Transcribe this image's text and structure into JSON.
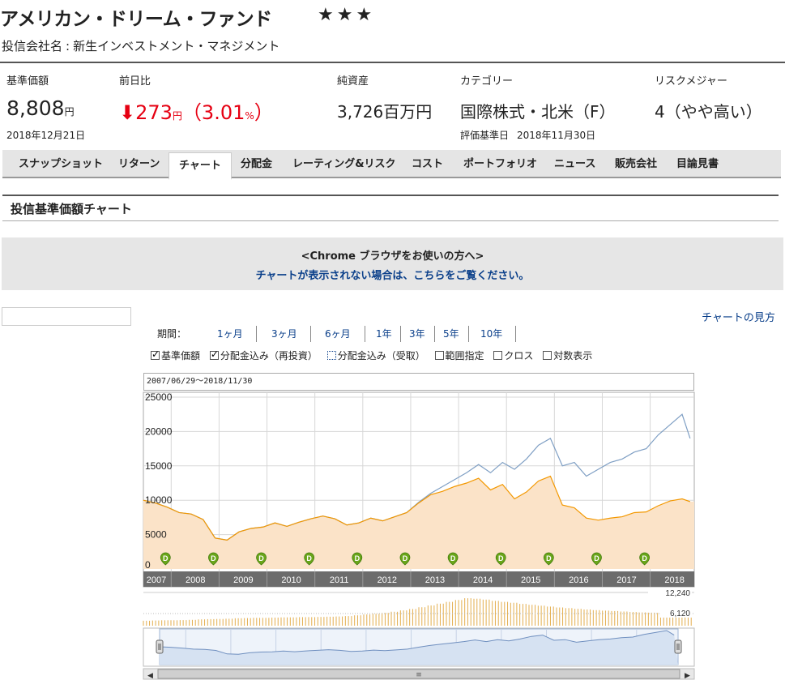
{
  "header": {
    "fund_name": "アメリカン・ドリーム・ファンド",
    "stars": "★★★",
    "company_label": "投信会社名",
    "company_name": "新生インベストメント・マネジメント"
  },
  "summary": {
    "nav": {
      "label": "基準価額",
      "value": "8,808",
      "unit": "円",
      "date": "2018年12月21日"
    },
    "change": {
      "label": "前日比",
      "arrow": "⬇",
      "value": "273",
      "unit": "円",
      "pct_open": "（3.01",
      "pct_unit": "%",
      "pct_close": "）"
    },
    "assets": {
      "label": "純資産",
      "value": "3,726百万円"
    },
    "category": {
      "label": "カテゴリー",
      "value": "国際株式・北米（F）",
      "basis_label": "評価基準日",
      "basis_date": "2018年11月30日"
    },
    "risk": {
      "label": "リスクメジャー",
      "value": "4（やや高い）"
    }
  },
  "tabs": [
    "スナップショット",
    "リターン",
    "チャート",
    "分配金",
    "レーティング&リスク",
    "コスト",
    "ポートフォリオ",
    "ニュース",
    "販売会社",
    "目論見書"
  ],
  "active_tab": "チャート",
  "section_title": "投信基準価額チャート",
  "notice": {
    "line1": "<Chrome ブラウザをお使いの方へ>",
    "line2": "チャートが表示されない場合は、こちらをご覧ください。"
  },
  "howto_link": "チャートの見方",
  "period": {
    "label": "期間：",
    "options": [
      "1ヶ月",
      "3ヶ月",
      "6ヶ月",
      "1年",
      "3年",
      "5年",
      "10年"
    ]
  },
  "options": [
    {
      "label": "基準価額",
      "checked": true
    },
    {
      "label": "分配金込み（再投資）",
      "checked": true
    },
    {
      "label": "分配金込み（受取）",
      "checked": false,
      "focused": true
    },
    {
      "label": "範囲指定",
      "checked": false
    },
    {
      "label": "クロス",
      "checked": false
    },
    {
      "label": "対数表示",
      "checked": false
    }
  ],
  "date_range": "2007/06/29～2018/11/30",
  "colors": {
    "nav_line": "#f39800",
    "nav_fill": "#fbe3c8",
    "reinvest_line": "#7f9fc4",
    "volume": "#e0a53a",
    "dividend_marker": "#6aa51a",
    "axis_band": "#6c6c6c",
    "link": "#0a3f8a",
    "down": "#e60012"
  },
  "chart_data": {
    "type": "line",
    "x": [
      "2007-06",
      "2007-09",
      "2007-12",
      "2008-03",
      "2008-06",
      "2008-09",
      "2008-12",
      "2009-03",
      "2009-06",
      "2009-09",
      "2009-12",
      "2010-03",
      "2010-06",
      "2010-09",
      "2010-12",
      "2011-03",
      "2011-06",
      "2011-09",
      "2011-12",
      "2012-03",
      "2012-06",
      "2012-09",
      "2012-12",
      "2013-03",
      "2013-06",
      "2013-09",
      "2013-12",
      "2014-03",
      "2014-06",
      "2014-09",
      "2014-12",
      "2015-03",
      "2015-06",
      "2015-09",
      "2015-12",
      "2016-03",
      "2016-06",
      "2016-09",
      "2016-12",
      "2017-03",
      "2017-06",
      "2017-09",
      "2017-12",
      "2018-03",
      "2018-06",
      "2018-09",
      "2018-11"
    ],
    "series": [
      {
        "name": "基準価額",
        "values": [
          10000,
          9600,
          9000,
          8200,
          8000,
          7200,
          4500,
          4200,
          5400,
          5900,
          6100,
          6700,
          6200,
          6800,
          7300,
          7700,
          7300,
          6400,
          6700,
          7400,
          7000,
          7600,
          8200,
          9600,
          10800,
          11300,
          12000,
          12500,
          13200,
          11500,
          12300,
          10200,
          11200,
          12800,
          13500,
          9300,
          8900,
          7400,
          7100,
          7400,
          7600,
          8200,
          8300,
          9200,
          9900,
          10200,
          9800
        ]
      },
      {
        "name": "分配金込み（再投資）",
        "values": [
          10000,
          9600,
          9000,
          8200,
          8000,
          7200,
          4500,
          4200,
          5400,
          5900,
          6100,
          6700,
          6200,
          6800,
          7300,
          7700,
          7300,
          6400,
          6700,
          7400,
          7000,
          7600,
          8200,
          9700,
          11000,
          12000,
          13000,
          14000,
          15200,
          14000,
          15500,
          14500,
          16000,
          18000,
          19000,
          15000,
          15500,
          13500,
          14500,
          15500,
          16000,
          17000,
          17500,
          19500,
          21000,
          22500,
          19000
        ]
      }
    ],
    "ylim": [
      0,
      25000
    ],
    "yticks": [
      0,
      5000,
      10000,
      15000,
      20000,
      25000
    ],
    "year_labels": [
      "2007",
      "2008",
      "2009",
      "2010",
      "2011",
      "2012",
      "2013",
      "2014",
      "2015",
      "2016",
      "2017",
      "2018"
    ],
    "dividend_years": [
      "2008",
      "2009",
      "2010",
      "2011",
      "2012",
      "2013",
      "2014",
      "2015",
      "2016",
      "2017",
      "2018"
    ],
    "dividend_marker_label": "D",
    "volume_max_label": "12,240",
    "volume_mid_label": "6,120",
    "volume": [
      2200,
      2300,
      2400,
      2400,
      2500,
      2600,
      2800,
      2900,
      3000,
      3100,
      3300,
      3400,
      3500,
      3500,
      3600,
      3700,
      3700,
      3800,
      3800,
      3900,
      4000,
      4100,
      4300,
      4600,
      5000,
      5300,
      5700,
      6200,
      6800,
      7400,
      8200,
      9000,
      9800,
      10600,
      11400,
      12200,
      12000,
      11600,
      11000,
      10600,
      10200,
      9700,
      9300,
      8900,
      8500,
      8100,
      7800,
      7500,
      7200,
      6900,
      6700,
      6500,
      6300,
      6100,
      5900,
      5800,
      5700,
      5600,
      5500,
      5400
    ],
    "navigator_years": [
      "2008",
      "2009",
      "2010",
      "2011",
      "2012",
      "2013",
      "2014",
      "2015",
      "2016",
      "2017",
      "2018"
    ],
    "grid": true,
    "legend": "none"
  }
}
